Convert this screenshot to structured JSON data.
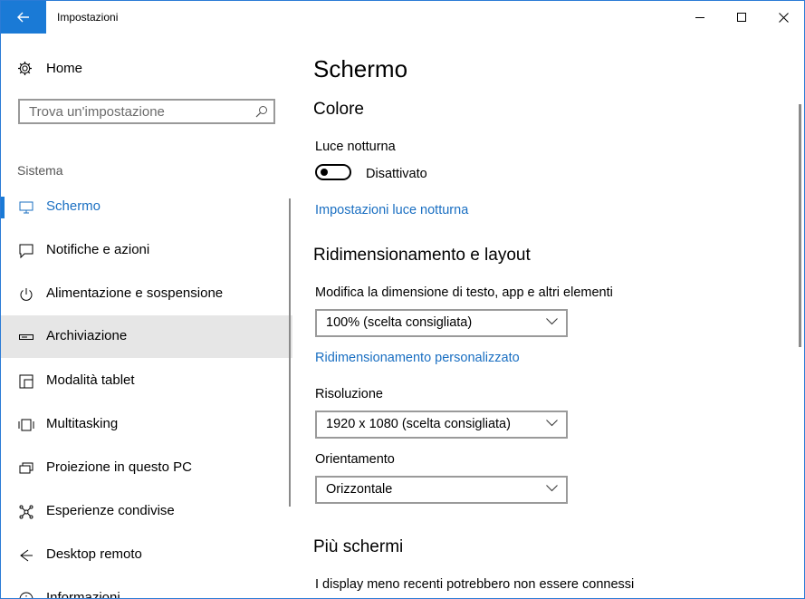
{
  "window": {
    "title": "Impostazioni"
  },
  "sidebar": {
    "home_label": "Home",
    "search_placeholder": "Trova un'impostazione",
    "section_label": "Sistema",
    "items": [
      {
        "label": "Schermo",
        "icon": "monitor-icon"
      },
      {
        "label": "Notifiche e azioni",
        "icon": "notification-icon"
      },
      {
        "label": "Alimentazione e sospensione",
        "icon": "power-icon"
      },
      {
        "label": "Archiviazione",
        "icon": "storage-icon"
      },
      {
        "label": "Modalità tablet",
        "icon": "tablet-icon"
      },
      {
        "label": "Multitasking",
        "icon": "multitasking-icon"
      },
      {
        "label": "Proiezione in questo PC",
        "icon": "projection-icon"
      },
      {
        "label": "Esperienze condivise",
        "icon": "shared-icon"
      },
      {
        "label": "Desktop remoto",
        "icon": "remote-desktop-icon"
      },
      {
        "label": "Informazioni",
        "icon": "info-icon"
      }
    ]
  },
  "main": {
    "page_title": "Schermo",
    "color_heading": "Colore",
    "night_light_label": "Luce notturna",
    "night_light_state": "Disattivato",
    "night_light_link": "Impostazioni luce notturna",
    "scaling_heading": "Ridimensionamento e layout",
    "scaling_label": "Modifica la dimensione di testo, app e altri elementi",
    "scaling_value": "100% (scelta consigliata)",
    "custom_scaling_link": "Ridimensionamento personalizzato",
    "resolution_label": "Risoluzione",
    "resolution_value": "1920 x 1080 (scelta consigliata)",
    "orientation_label": "Orientamento",
    "orientation_value": "Orizzontale",
    "multi_display_heading": "Più schermi",
    "multi_display_text": "I display meno recenti potrebbero non essere connessi"
  },
  "colors": {
    "accent": "#1a7ad6",
    "link": "#1a6fc2"
  }
}
